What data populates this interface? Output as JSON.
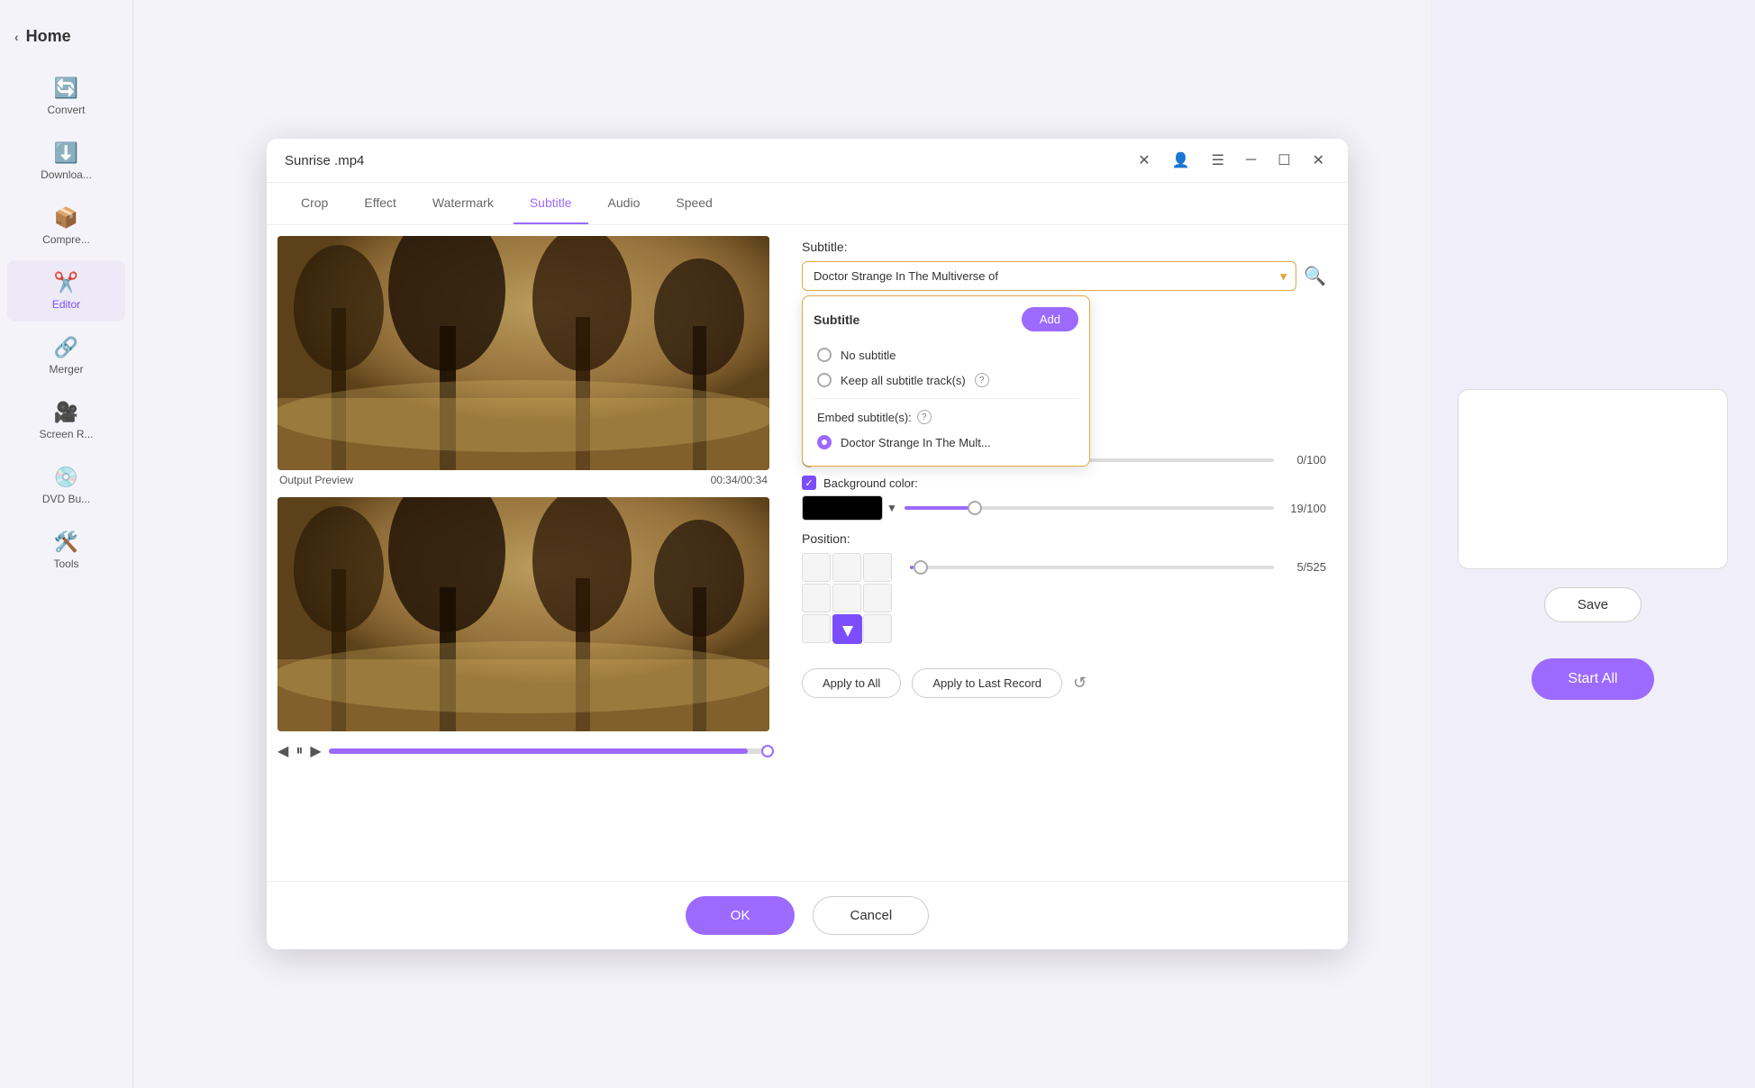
{
  "app": {
    "title": "Sunrise .mp4",
    "window_controls": [
      "close",
      "settings",
      "minimize",
      "maximize",
      "close2"
    ]
  },
  "sidebar": {
    "home_label": "Home",
    "items": [
      {
        "id": "convert",
        "label": "Convert",
        "icon": "⟳"
      },
      {
        "id": "download",
        "label": "Download",
        "icon": "⬇"
      },
      {
        "id": "compress",
        "label": "Compre...",
        "icon": "⊞"
      },
      {
        "id": "editor",
        "label": "Editor",
        "icon": "✂",
        "active": true
      },
      {
        "id": "merger",
        "label": "Merger",
        "icon": "⊞"
      },
      {
        "id": "screenr",
        "label": "Screen R...",
        "icon": "⊙"
      },
      {
        "id": "dvd",
        "label": "DVD Bu...",
        "icon": "◉"
      },
      {
        "id": "tools",
        "label": "Tools",
        "icon": "⊞"
      }
    ]
  },
  "dialog": {
    "title": "Sunrise .mp4",
    "tabs": [
      {
        "id": "crop",
        "label": "Crop"
      },
      {
        "id": "effect",
        "label": "Effect"
      },
      {
        "id": "watermark",
        "label": "Watermark"
      },
      {
        "id": "subtitle",
        "label": "Subtitle",
        "active": true
      },
      {
        "id": "audio",
        "label": "Audio"
      },
      {
        "id": "speed",
        "label": "Speed"
      }
    ]
  },
  "video": {
    "output_preview_label": "Output Preview",
    "timestamp": "00:34/00:34"
  },
  "subtitle_panel": {
    "subtitle_label": "Subtitle:",
    "selected_subtitle": "Doctor Strange In The Multiverse of ",
    "search_placeholder": "Search",
    "dropdown": {
      "title": "Subtitle",
      "add_button": "Add",
      "options": [
        {
          "id": "no_subtitle",
          "label": "No subtitle",
          "selected": false
        },
        {
          "id": "keep_all",
          "label": "Keep all subtitle track(s)",
          "selected": false,
          "has_help": true
        },
        {
          "id": "embed",
          "label": "Embed subtitle(s):",
          "is_section": true,
          "has_help": true
        },
        {
          "id": "doctor_strange",
          "label": "Doctor Strange In The Mult...",
          "selected": true
        }
      ]
    },
    "opacity_value": "0/100",
    "background_color_label": "Background color:",
    "bg_color_value": "#000000",
    "bg_opacity_value": "19/100",
    "position_label": "Position:",
    "position_value": "5/525",
    "apply_to_all": "Apply to All",
    "apply_to_last": "Apply to Last Record",
    "ok_button": "OK",
    "cancel_button": "Cancel"
  },
  "right_panel": {
    "save_button": "Save",
    "start_all_button": "Start All"
  }
}
